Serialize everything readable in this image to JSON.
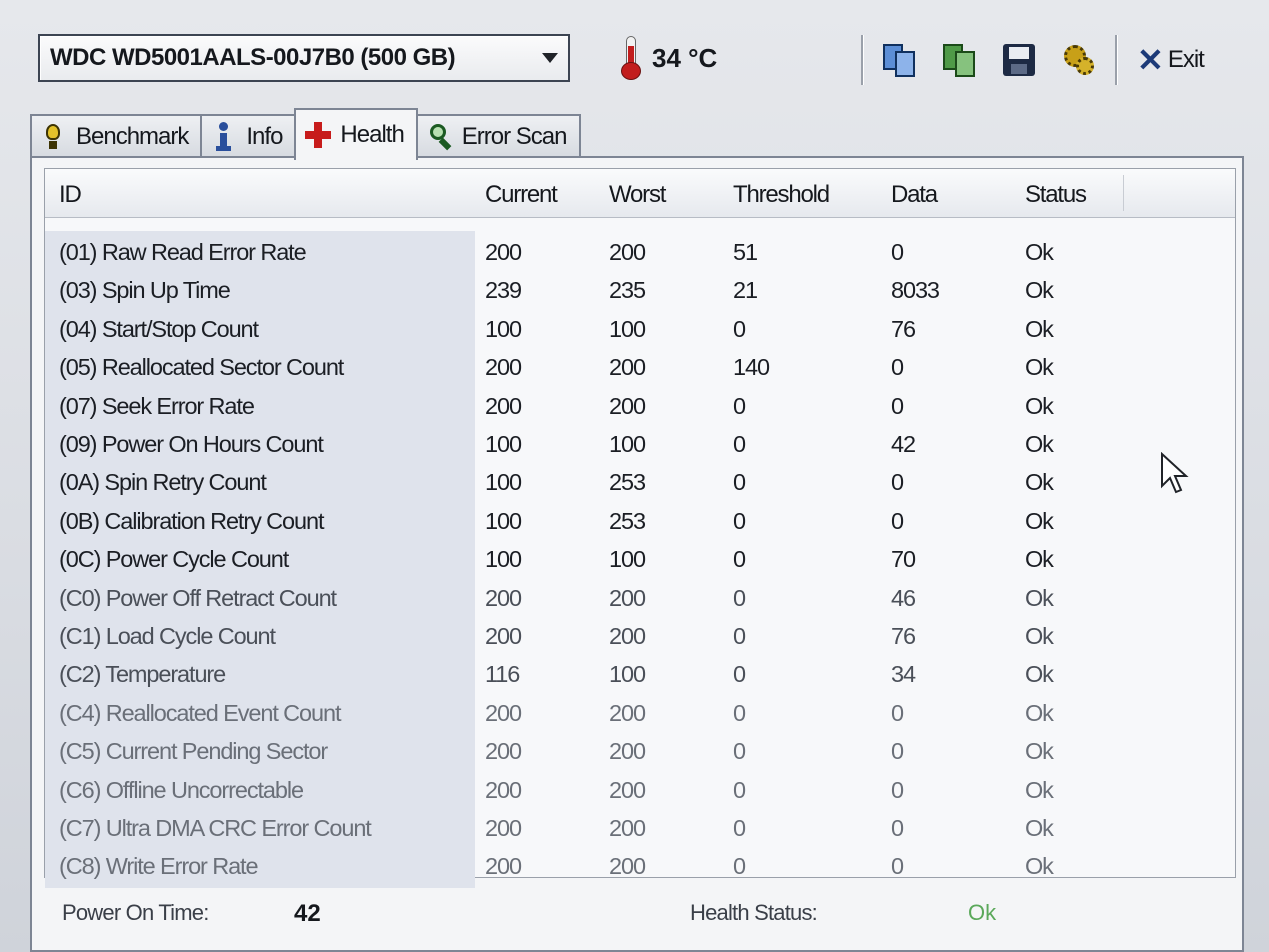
{
  "toolbar": {
    "drive": "WDC WD5001AALS-00J7B0 (500 GB)",
    "temperature": "34 °C",
    "buttons": [
      "copy-icon",
      "copy-alt-icon",
      "save-icon",
      "settings-icon"
    ],
    "exit_label": "Exit"
  },
  "tabs": [
    {
      "label": "Benchmark",
      "icon": "bulb-icon",
      "active": false
    },
    {
      "label": "Info",
      "icon": "info-icon",
      "active": false
    },
    {
      "label": "Health",
      "icon": "health-cross-icon",
      "active": true
    },
    {
      "label": "Error Scan",
      "icon": "magnifier-icon",
      "active": false
    }
  ],
  "health_table": {
    "columns": [
      "ID",
      "Current",
      "Worst",
      "Threshold",
      "Data",
      "Status"
    ],
    "rows": [
      {
        "id": "(01) Raw Read Error Rate",
        "current": "200",
        "worst": "200",
        "threshold": "51",
        "data": "0",
        "status": "Ok"
      },
      {
        "id": "(03) Spin Up Time",
        "current": "239",
        "worst": "235",
        "threshold": "21",
        "data": "8033",
        "status": "Ok"
      },
      {
        "id": "(04) Start/Stop Count",
        "current": "100",
        "worst": "100",
        "threshold": "0",
        "data": "76",
        "status": "Ok"
      },
      {
        "id": "(05) Reallocated Sector Count",
        "current": "200",
        "worst": "200",
        "threshold": "140",
        "data": "0",
        "status": "Ok"
      },
      {
        "id": "(07) Seek Error Rate",
        "current": "200",
        "worst": "200",
        "threshold": "0",
        "data": "0",
        "status": "Ok"
      },
      {
        "id": "(09) Power On Hours Count",
        "current": "100",
        "worst": "100",
        "threshold": "0",
        "data": "42",
        "status": "Ok"
      },
      {
        "id": "(0A) Spin Retry Count",
        "current": "100",
        "worst": "253",
        "threshold": "0",
        "data": "0",
        "status": "Ok"
      },
      {
        "id": "(0B) Calibration Retry Count",
        "current": "100",
        "worst": "253",
        "threshold": "0",
        "data": "0",
        "status": "Ok"
      },
      {
        "id": "(0C) Power Cycle Count",
        "current": "100",
        "worst": "100",
        "threshold": "0",
        "data": "70",
        "status": "Ok"
      },
      {
        "id": "(C0) Power Off Retract Count",
        "current": "200",
        "worst": "200",
        "threshold": "0",
        "data": "46",
        "status": "Ok"
      },
      {
        "id": "(C1) Load Cycle Count",
        "current": "200",
        "worst": "200",
        "threshold": "0",
        "data": "76",
        "status": "Ok"
      },
      {
        "id": "(C2) Temperature",
        "current": "116",
        "worst": "100",
        "threshold": "0",
        "data": "34",
        "status": "Ok"
      },
      {
        "id": "(C4) Reallocated Event Count",
        "current": "200",
        "worst": "200",
        "threshold": "0",
        "data": "0",
        "status": "Ok"
      },
      {
        "id": "(C5) Current Pending Sector",
        "current": "200",
        "worst": "200",
        "threshold": "0",
        "data": "0",
        "status": "Ok"
      },
      {
        "id": "(C6) Offline Uncorrectable",
        "current": "200",
        "worst": "200",
        "threshold": "0",
        "data": "0",
        "status": "Ok"
      },
      {
        "id": "(C7) Ultra DMA CRC Error Count",
        "current": "200",
        "worst": "200",
        "threshold": "0",
        "data": "0",
        "status": "Ok"
      },
      {
        "id": "(C8) Write Error Rate",
        "current": "200",
        "worst": "200",
        "threshold": "0",
        "data": "0",
        "status": "Ok"
      }
    ]
  },
  "footer": {
    "power_on_label": "Power On Time:",
    "power_on_value": "42",
    "health_label": "Health Status:",
    "health_value": "Ok"
  },
  "colors": {
    "health_ok": "#5aa85a",
    "row_highlight": "#dfe3ec",
    "thermometer": "#c21d1d"
  }
}
